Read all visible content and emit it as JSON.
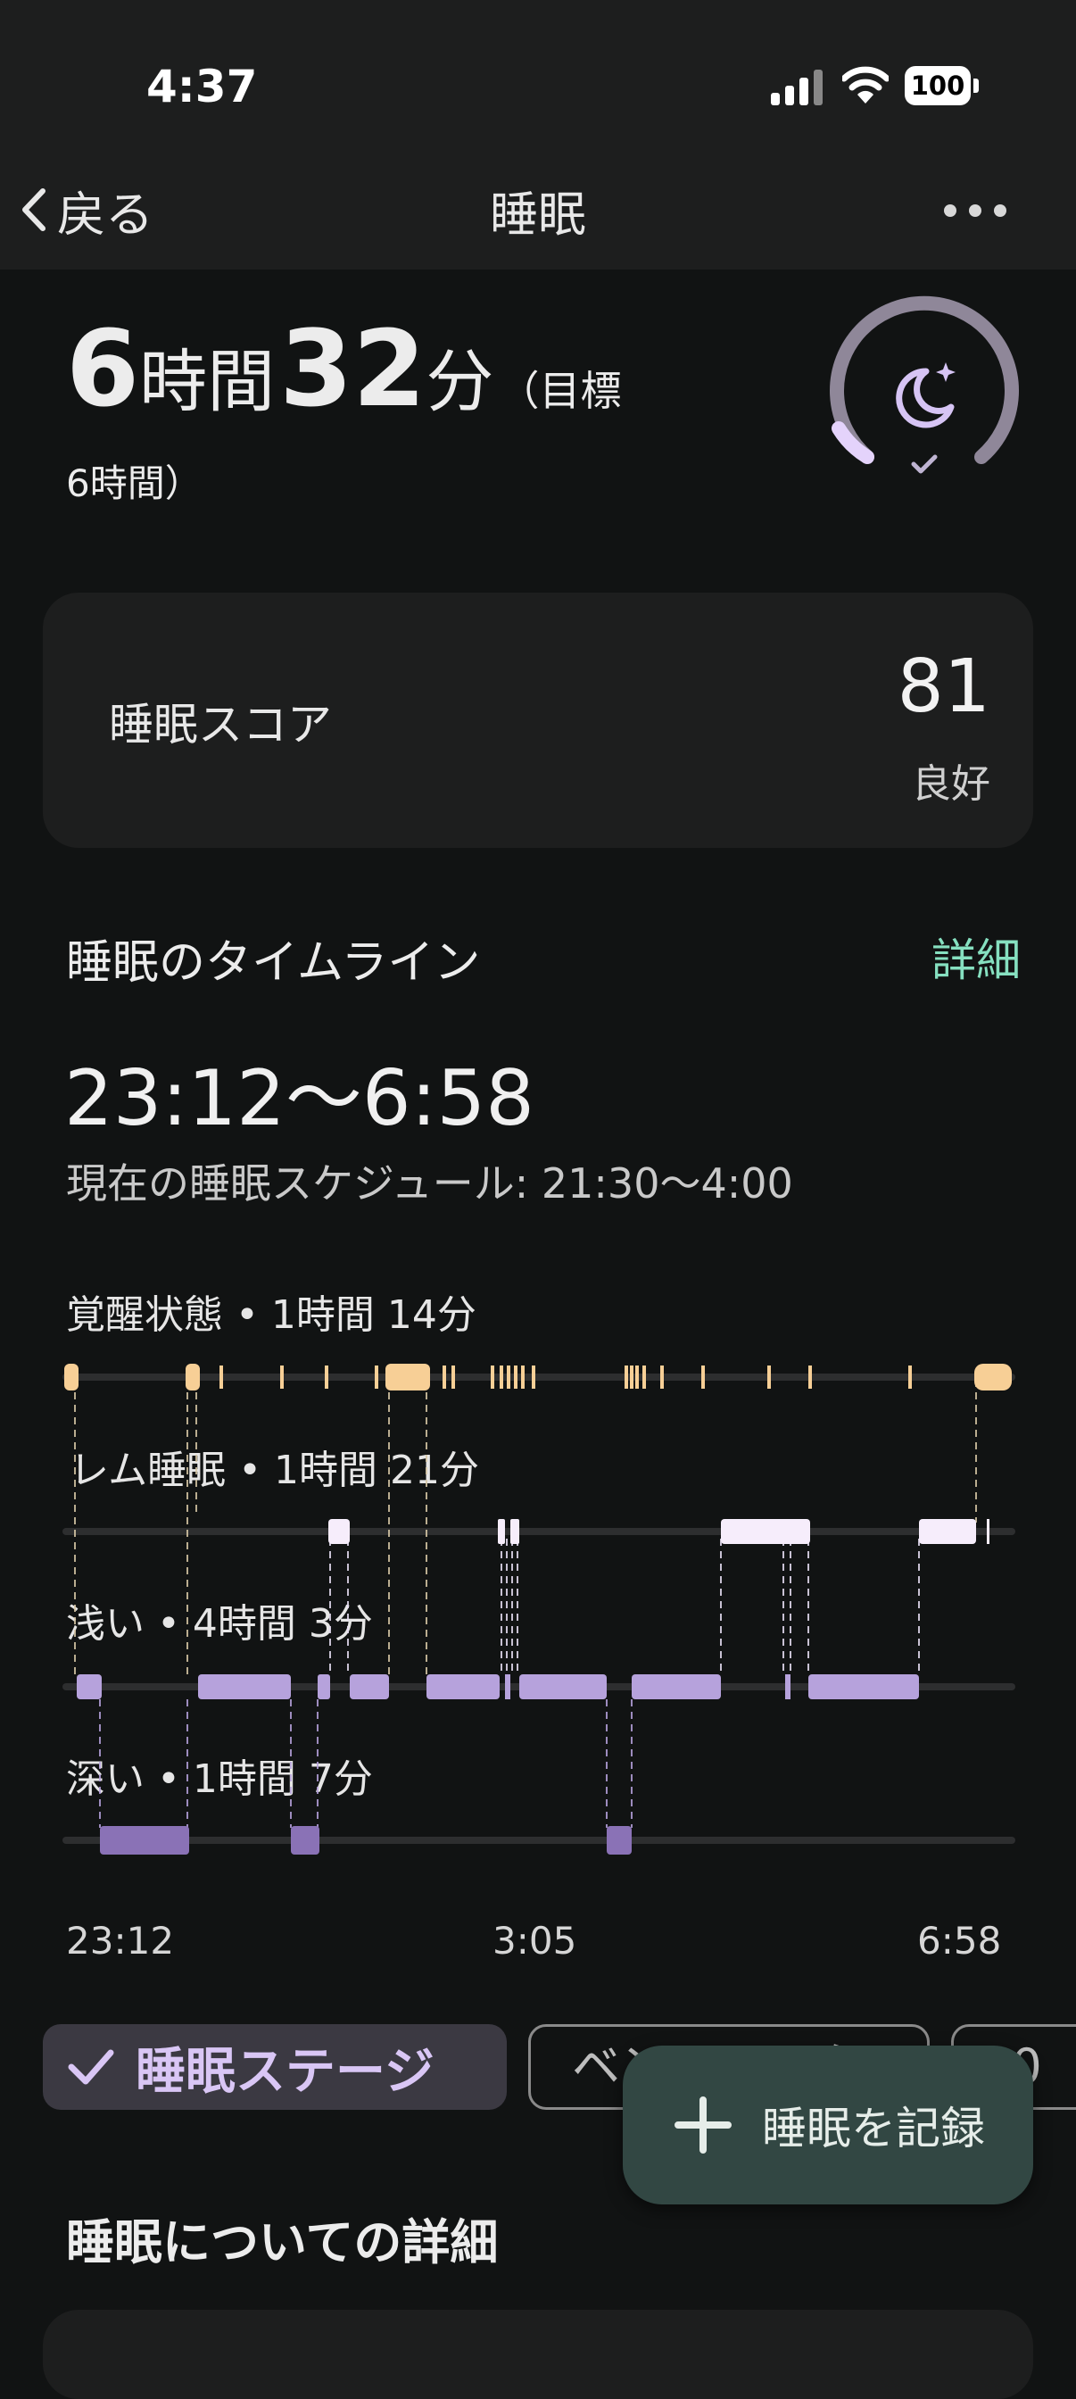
{
  "status_bar": {
    "time": "4:37",
    "battery": "100"
  },
  "nav": {
    "back_label": "戻る",
    "title": "睡眠"
  },
  "summary": {
    "hours_value": "6",
    "hours_unit": "時間",
    "minutes_value": "32",
    "minutes_unit": "分",
    "goal_prefix": "（目標",
    "goal_suffix": "6時間）",
    "ring_icon": "moon-stars-icon",
    "ring_check_icon": "check-icon"
  },
  "score": {
    "label": "睡眠スコア",
    "value": "81",
    "description": "良好"
  },
  "timeline": {
    "heading": "睡眠のタイムライン",
    "details_link": "詳細",
    "range": "23:12〜6:58",
    "schedule": "現在の睡眠スケジュール: 21:30〜4:00",
    "stages": [
      {
        "label": "覚醒状態 • 1時間 14分",
        "color": "#f7cf96"
      },
      {
        "label": "レム睡眠 • 1時間 21分",
        "color": "#f6edfb"
      },
      {
        "label": "浅い • 4時間 3分",
        "color": "#b6a2dc"
      },
      {
        "label": "深い • 1時間 7分",
        "color": "#8a72b6"
      }
    ],
    "axis": {
      "start": "23:12",
      "mid": "3:05",
      "end": "6:58"
    }
  },
  "chips": {
    "stages_label": "睡眠ステージ",
    "benchmark_label": "ベンチマーク",
    "period_label": "30"
  },
  "fab": {
    "label": "睡眠を記録",
    "icon": "plus-icon"
  },
  "details_heading": "睡眠についての詳細"
}
